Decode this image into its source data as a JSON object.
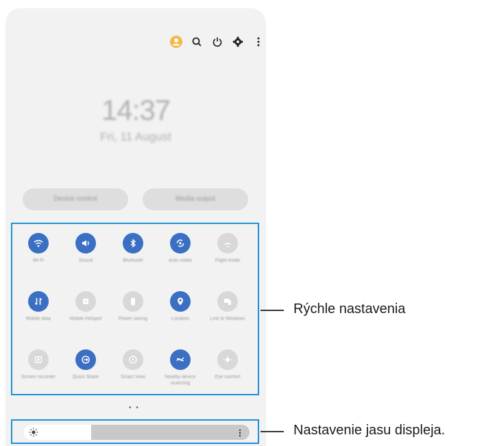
{
  "status": {
    "time": "14:37",
    "date": "Fri, 11 August"
  },
  "shortcuts": {
    "device_control": "Device control",
    "media_output": "Media output"
  },
  "quick_settings": [
    {
      "label": "Wi-Fi",
      "icon": "wifi-icon",
      "active": true
    },
    {
      "label": "Sound",
      "icon": "sound-icon",
      "active": true
    },
    {
      "label": "Bluetooth",
      "icon": "bluetooth-icon",
      "active": true
    },
    {
      "label": "Auto rotate",
      "icon": "auto-rotate-icon",
      "active": true
    },
    {
      "label": "Flight mode",
      "icon": "airplane-icon",
      "active": false
    },
    {
      "label": "Mobile data",
      "icon": "mobile-data-icon",
      "active": true
    },
    {
      "label": "Mobile Hotspot",
      "icon": "hotspot-icon",
      "active": false
    },
    {
      "label": "Power saving",
      "icon": "power-saving-icon",
      "active": false
    },
    {
      "label": "Location",
      "icon": "location-icon",
      "active": true
    },
    {
      "label": "Link to Windows",
      "icon": "link-windows-icon",
      "active": false
    },
    {
      "label": "Screen recorder",
      "icon": "screen-recorder-icon",
      "active": false
    },
    {
      "label": "Quick Share",
      "icon": "quick-share-icon",
      "active": true
    },
    {
      "label": "Smart View",
      "icon": "smart-view-icon",
      "active": false
    },
    {
      "label": "Nearby device scanning",
      "icon": "nearby-scan-icon",
      "active": true
    },
    {
      "label": "Eye comfort",
      "icon": "eye-comfort-icon",
      "active": false
    }
  ],
  "brightness": {
    "level": 0.3
  },
  "page_indicator": "• •",
  "callouts": {
    "quick_settings": "Rýchle nastavenia",
    "brightness": "Nastavenie jasu displeja."
  },
  "colors": {
    "accent": "#3a6fc4",
    "highlight_border": "#1f8fd6",
    "profile": "#f1b94a"
  }
}
